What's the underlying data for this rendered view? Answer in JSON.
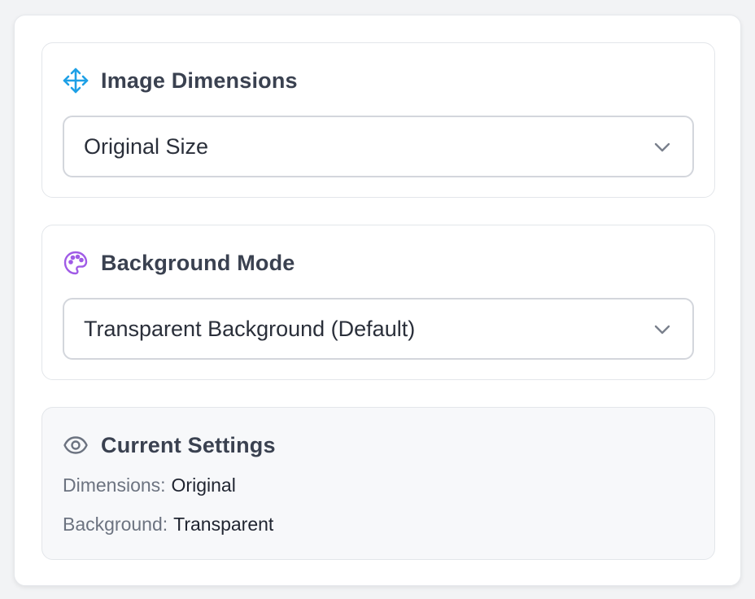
{
  "dimensions_section": {
    "title": "Image Dimensions",
    "icon": "move-arrows-icon",
    "select_value": "Original Size"
  },
  "background_section": {
    "title": "Background Mode",
    "icon": "palette-icon",
    "select_value": "Transparent Background (Default)"
  },
  "current_settings": {
    "title": "Current Settings",
    "icon": "eye-icon",
    "dimensions_label": "Dimensions:",
    "dimensions_value": "Original",
    "background_label": "Background:",
    "background_value": "Transparent"
  },
  "colors": {
    "move_icon": "#1ea0e6",
    "palette_icon": "#a05be6",
    "eye_icon": "#6c7380"
  }
}
